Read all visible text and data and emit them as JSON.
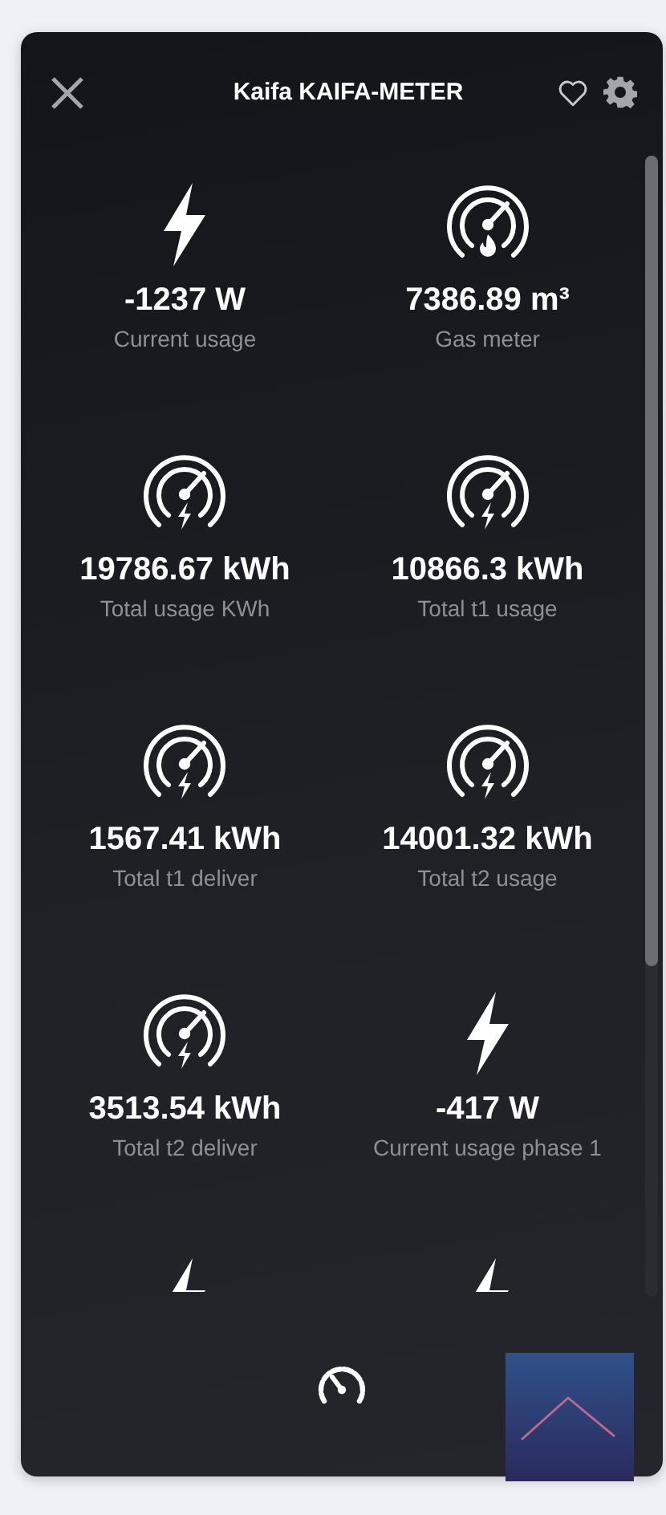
{
  "header": {
    "title": "Kaifa KAIFA-METER",
    "favorite": false
  },
  "tiles": [
    {
      "kind": "bolt",
      "value": "-1237 W",
      "label": "Current usage"
    },
    {
      "kind": "gauge-flame",
      "value": "7386.89 m³",
      "label": "Gas meter"
    },
    {
      "kind": "gauge-bolt",
      "value": "19786.67 kWh",
      "label": "Total usage KWh"
    },
    {
      "kind": "gauge-bolt",
      "value": "10866.3 kWh",
      "label": "Total t1 usage"
    },
    {
      "kind": "gauge-bolt",
      "value": "1567.41 kWh",
      "label": "Total t1 deliver"
    },
    {
      "kind": "gauge-bolt",
      "value": "14001.32 kWh",
      "label": "Total t2 usage"
    },
    {
      "kind": "gauge-bolt",
      "value": "3513.54 kWh",
      "label": "Total t2 deliver"
    },
    {
      "kind": "bolt",
      "value": "-417 W",
      "label": "Current usage phase 1"
    },
    {
      "kind": "bolt"
    },
    {
      "kind": "bolt"
    }
  ]
}
